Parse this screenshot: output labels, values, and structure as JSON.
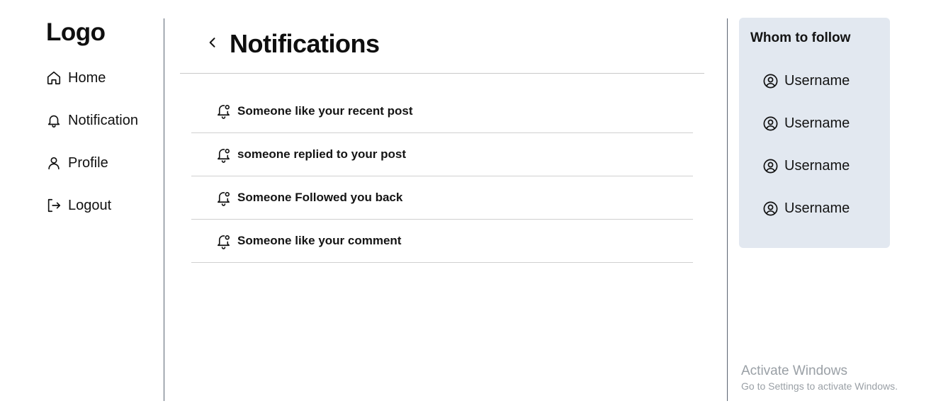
{
  "sidebar": {
    "logo": "Logo",
    "items": [
      {
        "label": "Home",
        "icon": "home-icon"
      },
      {
        "label": "Notification",
        "icon": "bell-icon"
      },
      {
        "label": "Profile",
        "icon": "user-icon"
      },
      {
        "label": "Logout",
        "icon": "logout-icon"
      }
    ]
  },
  "main": {
    "title": "Notifications",
    "notifications": [
      {
        "text": "Someone like your recent post",
        "icon": "bell-dot-icon"
      },
      {
        "text": "someone replied to your post",
        "icon": "bell-dot-icon"
      },
      {
        "text": "Someone Followed you back",
        "icon": "bell-dot-icon"
      },
      {
        "text": "Someone like your comment",
        "icon": "bell-dot-icon"
      }
    ]
  },
  "follow": {
    "title": "Whom to follow",
    "users": [
      {
        "name": "Username",
        "icon": "user-circle-icon"
      },
      {
        "name": "Username",
        "icon": "user-circle-icon"
      },
      {
        "name": "Username",
        "icon": "user-circle-icon"
      },
      {
        "name": "Username",
        "icon": "user-circle-icon"
      }
    ]
  },
  "watermark": {
    "title": "Activate Windows",
    "subtitle": "Go to Settings to activate Windows."
  },
  "colors": {
    "panel_bg": "#e2e8f0",
    "divider": "#5a6472"
  }
}
